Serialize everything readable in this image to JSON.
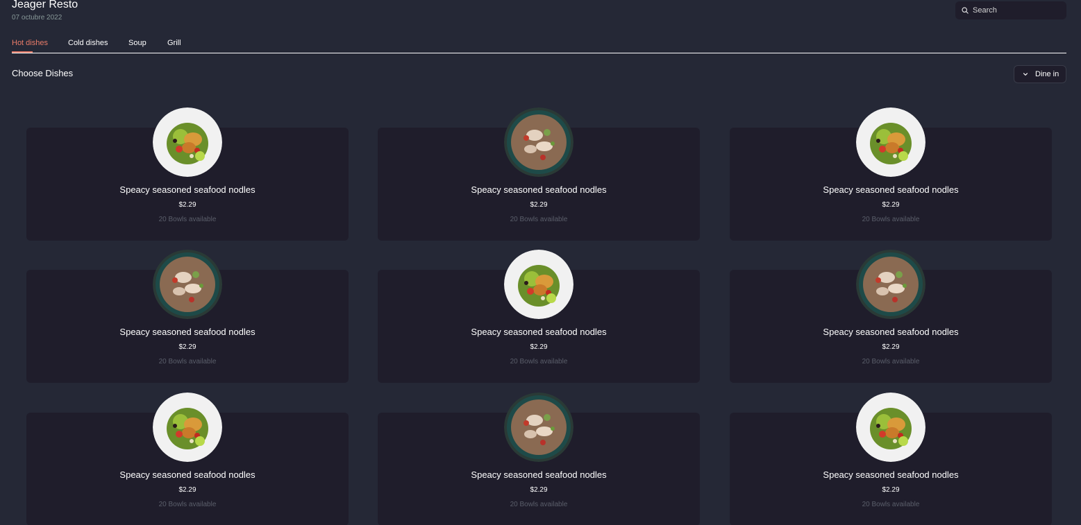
{
  "header": {
    "title": "Jeager Resto",
    "date": "07 octubre 2022",
    "search_placeholder": "Search"
  },
  "tabs": [
    {
      "label": "Hot dishes",
      "active": true
    },
    {
      "label": "Cold dishes",
      "active": false
    },
    {
      "label": "Soup",
      "active": false
    },
    {
      "label": "Grill",
      "active": false
    }
  ],
  "section": {
    "title": "Choose Dishes",
    "order_type": "Dine in"
  },
  "colors": {
    "background": "#252836",
    "card": "#1f1d2b",
    "accent": "#ea7c69",
    "muted_text": "#889898"
  },
  "dishes": [
    {
      "name": "Speacy seasoned seafood nodles",
      "price": "$2.29",
      "availability": "20 Bowls available",
      "image": "salad-plate-icon"
    },
    {
      "name": "Speacy seasoned seafood nodles",
      "price": "$2.29",
      "availability": "20 Bowls available",
      "image": "seafood-bowl-icon"
    },
    {
      "name": "Speacy seasoned seafood nodles",
      "price": "$2.29",
      "availability": "20 Bowls available",
      "image": "salad-plate-icon"
    },
    {
      "name": "Speacy seasoned seafood nodles",
      "price": "$2.29",
      "availability": "20 Bowls available",
      "image": "seafood-bowl-icon"
    },
    {
      "name": "Speacy seasoned seafood nodles",
      "price": "$2.29",
      "availability": "20 Bowls available",
      "image": "salad-plate-icon"
    },
    {
      "name": "Speacy seasoned seafood nodles",
      "price": "$2.29",
      "availability": "20 Bowls available",
      "image": "seafood-bowl-icon"
    },
    {
      "name": "Speacy seasoned seafood nodles",
      "price": "$2.29",
      "availability": "20 Bowls available",
      "image": "salad-plate-icon"
    },
    {
      "name": "Speacy seasoned seafood nodles",
      "price": "$2.29",
      "availability": "20 Bowls available",
      "image": "seafood-bowl-icon"
    },
    {
      "name": "Speacy seasoned seafood nodles",
      "price": "$2.29",
      "availability": "20 Bowls available",
      "image": "salad-plate-icon"
    }
  ]
}
